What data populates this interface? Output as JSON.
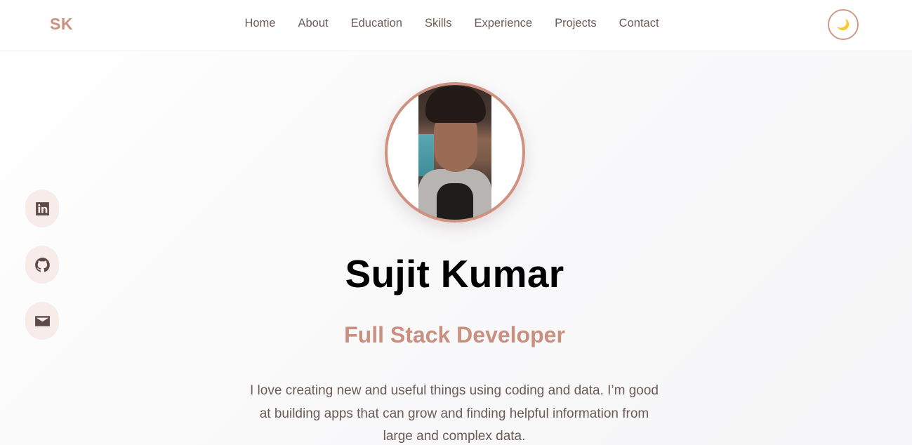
{
  "header": {
    "logo": "SK",
    "nav": [
      "Home",
      "About",
      "Education",
      "Skills",
      "Experience",
      "Projects",
      "Contact"
    ],
    "theme_toggle_icon": "moon-icon",
    "theme_toggle_glyph": "🌙"
  },
  "social": [
    {
      "name": "linkedin-icon"
    },
    {
      "name": "github-icon"
    },
    {
      "name": "mail-icon"
    }
  ],
  "hero": {
    "name": "Sujit Kumar",
    "role": "Full Stack Developer",
    "bio": "I love creating new and useful things using coding and data. I’m good at building apps that can grow and finding helpful information from large and complex data."
  },
  "colors": {
    "accent": "#c9907f",
    "text": "#6b5a55",
    "social_bg": "#f7ecea"
  }
}
